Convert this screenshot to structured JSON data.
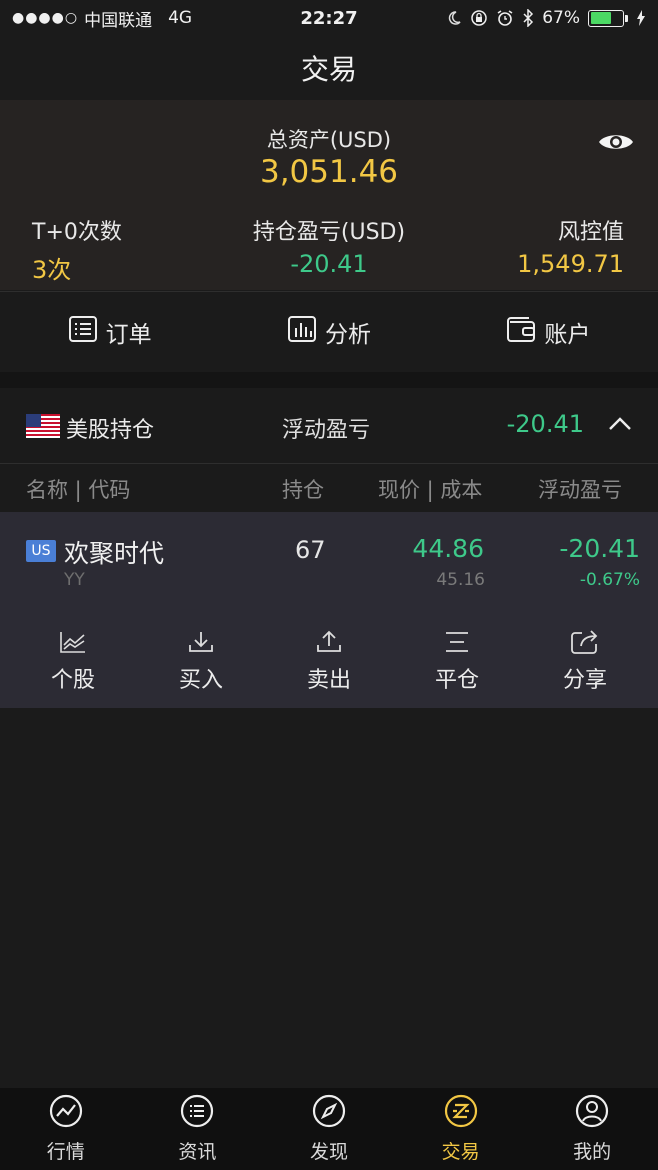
{
  "status_bar": {
    "carrier": "中国联通",
    "network": "4G",
    "time": "22:27",
    "battery_percent": "67%"
  },
  "nav": {
    "title": "交易"
  },
  "summary": {
    "total_assets_label": "总资产(USD)",
    "total_assets_value": "3,051.46",
    "t0_label": "T+0次数",
    "t0_value": "3次",
    "position_pl_label": "持仓盈亏(USD)",
    "position_pl_value": "-20.41",
    "risk_label": "风控值",
    "risk_value": "1,549.71"
  },
  "actions": [
    {
      "label": "订单",
      "icon": "order-list-icon"
    },
    {
      "label": "分析",
      "icon": "bar-chart-icon"
    },
    {
      "label": "账户",
      "icon": "wallet-icon"
    }
  ],
  "us_positions": {
    "title": "美股持仓",
    "floating_label": "浮动盈亏",
    "floating_value": "-20.41",
    "columns": [
      "名称 | 代码",
      "持仓",
      "现价 | 成本",
      "浮动盈亏"
    ]
  },
  "position": {
    "market_badge": "US",
    "name": "欢聚时代",
    "code": "YY",
    "quantity": "67",
    "price": "44.86",
    "cost": "45.16",
    "floating_pl": "-20.41",
    "floating_pl_pct": "-0.67%",
    "row_actions": [
      {
        "label": "个股",
        "icon": "stock-chart-icon"
      },
      {
        "label": "买入",
        "icon": "download-icon"
      },
      {
        "label": "卖出",
        "icon": "upload-icon"
      },
      {
        "label": "平仓",
        "icon": "close-position-icon"
      },
      {
        "label": "分享",
        "icon": "share-icon"
      }
    ]
  },
  "tabbar": [
    {
      "label": "行情",
      "icon": "market-icon"
    },
    {
      "label": "资讯",
      "icon": "news-icon"
    },
    {
      "label": "发现",
      "icon": "compass-icon"
    },
    {
      "label": "交易",
      "icon": "trade-icon",
      "active": true
    },
    {
      "label": "我的",
      "icon": "profile-icon"
    }
  ],
  "colors": {
    "accent_gold": "#f2c744",
    "loss_green": "#3ec98a",
    "us_badge": "#4a7fd6"
  }
}
